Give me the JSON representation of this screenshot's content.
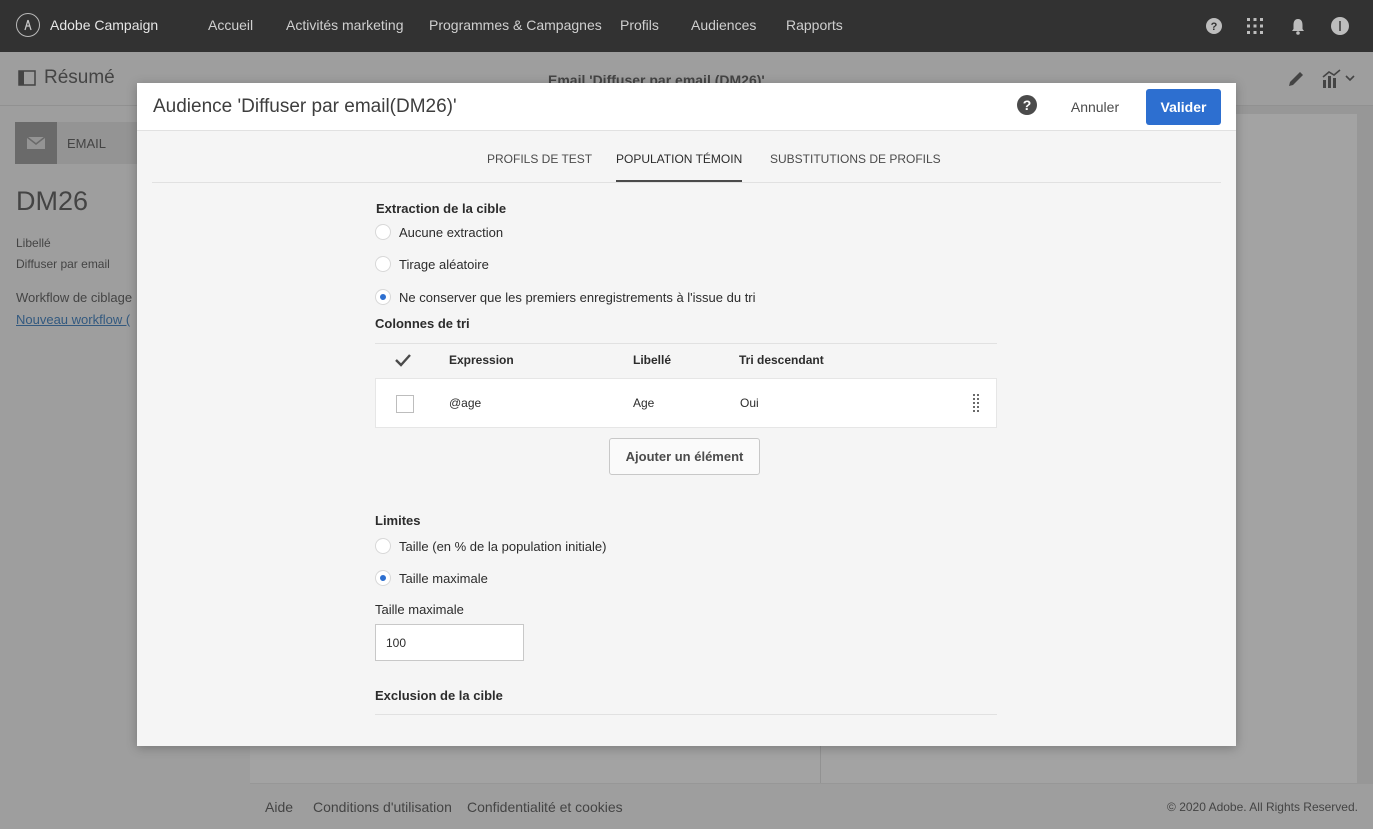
{
  "topnav": {
    "brand": "Adobe Campaign",
    "items": [
      "Accueil",
      "Activités marketing",
      "Programmes & Campagnes",
      "Profils",
      "Audiences",
      "Rapports"
    ],
    "icons": [
      "help-icon",
      "apps-grid-icon",
      "bell-icon",
      "user-avatar-icon"
    ]
  },
  "background": {
    "resume_label": "Résumé",
    "email_title": "Email 'Diffuser par email (DM26)'",
    "channel_label": "EMAIL",
    "code": "DM26",
    "libelle_label": "Libellé",
    "libelle_value": "Diffuser par email",
    "workflow_label": "Workflow de ciblage",
    "workflow_link": "Nouveau workflow ("
  },
  "footer": {
    "links": [
      "Aide",
      "Conditions d'utilisation",
      "Confidentialité et cookies"
    ],
    "copyright": "© 2020 Adobe. All Rights Reserved."
  },
  "dialog": {
    "title": "Audience 'Diffuser par email(DM26)'",
    "help": "?",
    "cancel_label": "Annuler",
    "validate_label": "Valider",
    "tabs": [
      {
        "label": "PROFILS DE TEST",
        "active": false
      },
      {
        "label": "POPULATION TÉMOIN",
        "active": true
      },
      {
        "label": "SUBSTITUTIONS DE PROFILS",
        "active": false
      }
    ],
    "extraction": {
      "title": "Extraction de la cible",
      "options": [
        {
          "label": "Aucune extraction",
          "checked": false
        },
        {
          "label": "Tirage aléatoire",
          "checked": false
        },
        {
          "label": "Ne conserver que les premiers enregistrements à l'issue du tri",
          "checked": true
        }
      ]
    },
    "sort": {
      "title": "Colonnes de tri",
      "headers": [
        "Expression",
        "Libellé",
        "Tri descendant"
      ],
      "rows": [
        {
          "expression": "@age",
          "libelle": "Age",
          "descendant": "Oui"
        }
      ],
      "add_label": "Ajouter un élément"
    },
    "limits": {
      "title": "Limites",
      "options": [
        {
          "label": "Taille (en % de la population initiale)",
          "checked": false
        },
        {
          "label": "Taille maximale",
          "checked": true
        }
      ],
      "field_label": "Taille maximale",
      "field_value": "100"
    },
    "exclusion_title": "Exclusion de la cible"
  },
  "colors": {
    "nav_bg": "#323232",
    "accent": "#2d6fd0",
    "dialog_bg": "#f5f5f5"
  }
}
